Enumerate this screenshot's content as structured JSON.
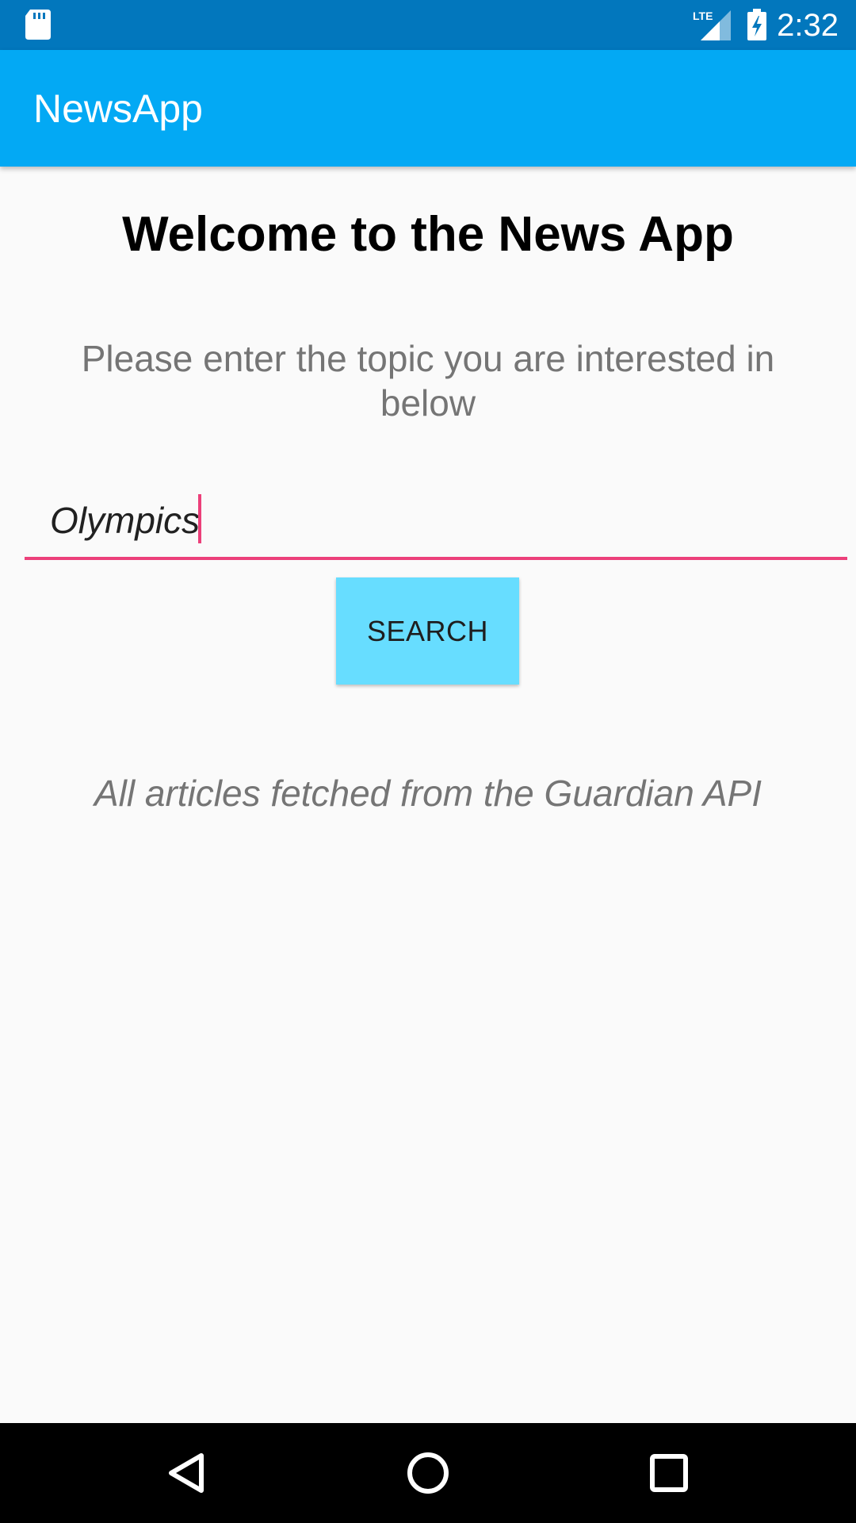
{
  "status_bar": {
    "time": "2:32",
    "network_label": "LTE",
    "icons": [
      "sd-card-icon",
      "signal-icon",
      "battery-charging-icon"
    ]
  },
  "app_bar": {
    "title": "NewsApp"
  },
  "main": {
    "title": "Welcome to the News App",
    "instruction": "Please enter the topic you are interested in below",
    "search_input": {
      "value": "Olympics",
      "placeholder": ""
    },
    "search_button_label": "SEARCH",
    "footer_note": "All articles fetched from the Guardian API"
  },
  "nav_bar": {
    "icons": [
      "back-icon",
      "home-icon",
      "recents-icon"
    ]
  },
  "colors": {
    "status_bar": "#0277BD",
    "app_bar": "#03A9F4",
    "accent": "#EC407A",
    "button": "#67DDFF",
    "background": "#FAFAFA",
    "secondary_text": "#757575"
  }
}
